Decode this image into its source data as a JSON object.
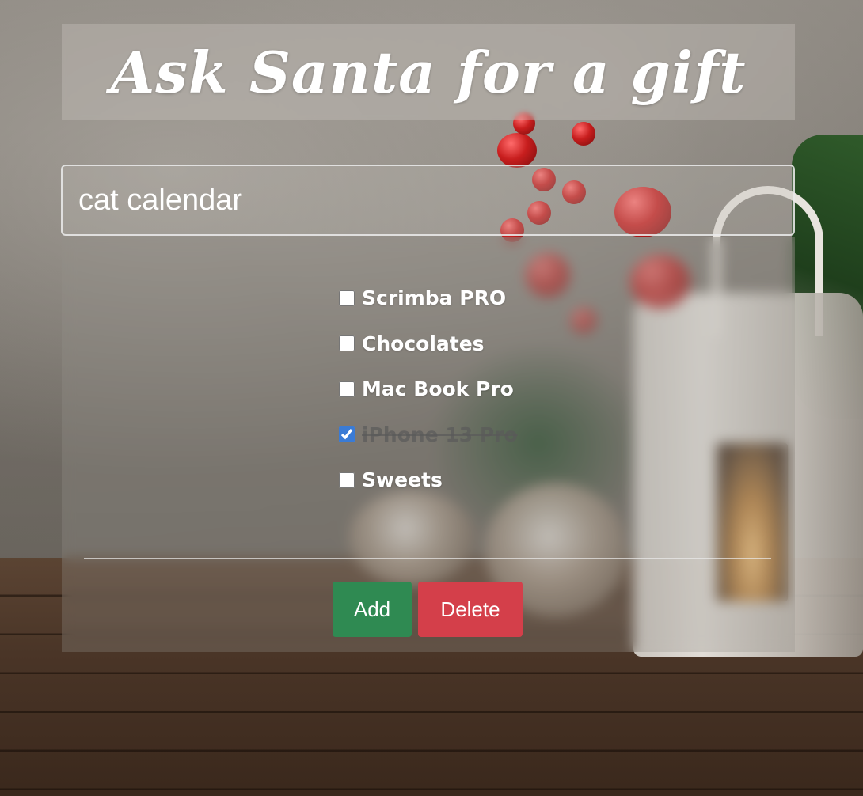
{
  "app": {
    "title": "Ask Santa for a gift"
  },
  "gift_input": {
    "value": "cat calendar"
  },
  "gifts": [
    {
      "label": "Scrimba PRO",
      "checked": false
    },
    {
      "label": "Chocolates",
      "checked": false
    },
    {
      "label": "Mac Book Pro",
      "checked": false
    },
    {
      "label": "iPhone 13 Pro",
      "checked": true
    },
    {
      "label": "Sweets",
      "checked": false
    }
  ],
  "actions": {
    "add_label": "Add",
    "delete_label": "Delete"
  },
  "colors": {
    "add": "#2f8a52",
    "delete": "#d43f4a",
    "checkbox_accent": "#3a7bd5"
  }
}
